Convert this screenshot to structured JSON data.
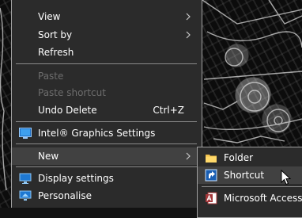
{
  "main_menu": {
    "items": {
      "view": "View",
      "sort_by": "Sort by",
      "refresh": "Refresh",
      "paste": "Paste",
      "paste_shortcut": "Paste shortcut",
      "undo_delete": "Undo Delete",
      "undo_delete_shortcut": "Ctrl+Z",
      "intel_graphics": "Intel® Graphics Settings",
      "new": "New",
      "display_settings": "Display settings",
      "personalise": "Personalise"
    },
    "icons": {
      "intel_graphics": "intel-graphics-icon",
      "display_settings": "display-icon",
      "personalise": "personalise-icon",
      "submenu_arrow": "chevron-right-icon"
    }
  },
  "new_submenu": {
    "items": {
      "folder": "Folder",
      "shortcut": "Shortcut",
      "access": "Microsoft Access D"
    },
    "icons": {
      "folder": "folder-icon",
      "shortcut": "shortcut-icon",
      "access": "microsoft-access-icon"
    }
  },
  "colors": {
    "menu_background": "#2b2b2b",
    "menu_border": "#a0a0a0",
    "highlight": "#414141",
    "disabled_text": "#6d6d6d",
    "text": "#ffffff"
  }
}
